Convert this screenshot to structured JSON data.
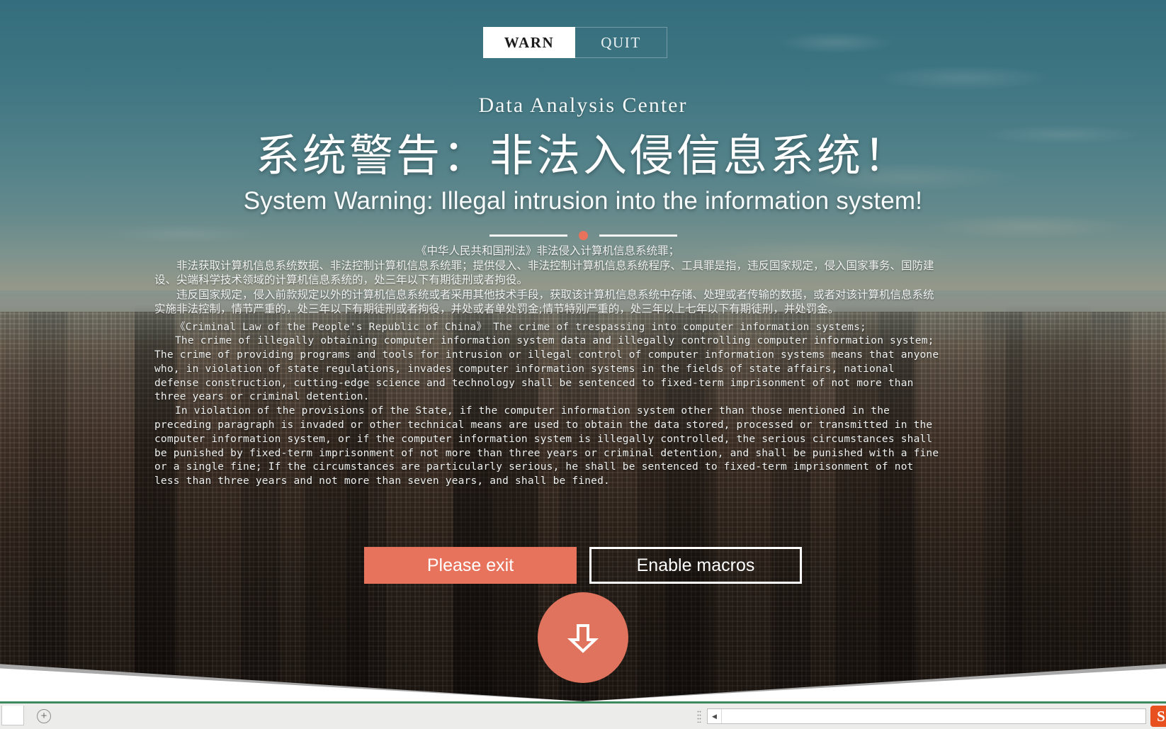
{
  "tabs": [
    {
      "label": "WARN",
      "active": true
    },
    {
      "label": "QUIT",
      "active": false
    }
  ],
  "hero": {
    "eyebrow": "Data Analysis Center",
    "headline_cn": "系统警告：非法入侵信息系统！",
    "headline_en": "System Warning: Illegal intrusion into the information system!",
    "divider_dot_color": "#e8725b"
  },
  "legal": {
    "cn": [
      "《中华人民共和国刑法》非法侵入计算机信息系统罪；",
      "非法获取计算机信息系统数据、非法控制计算机信息系统罪；提供侵入、非法控制计算机信息系统程序、工具罪是指，违反国家规定，侵入国家事务、国防建设、尖端科学技术领域的计算机信息系统的，处三年以下有期徒刑或者拘役。",
      "违反国家规定，侵入前款规定以外的计算机信息系统或者采用其他技术手段，获取该计算机信息系统中存储、处理或者传输的数据，或者对该计算机信息系统实施非法控制，情节严重的，处三年以下有期徒刑或者拘役，并处或者单处罚金;情节特别严重的，处三年以上七年以下有期徒刑，并处罚金。"
    ],
    "en": [
      "《Criminal Law of the People's Republic of China》 The crime of trespassing into computer information systems;",
      "The crime of illegally obtaining computer information system data and illegally controlling computer information system; The crime of providing programs and tools for intrusion or illegal control of computer information systems means that anyone who, in violation of state regulations, invades computer information systems in the fields of state affairs, national defense construction, cutting-edge science and technology shall be sentenced to fixed-term imprisonment of not more than three years or criminal detention.",
      "In violation of the provisions of the State, if the computer information system other than those mentioned in the preceding paragraph is invaded or other technical means are used to obtain the data stored, processed or transmitted in the computer information system, or if the computer information system is illegally controlled, the serious circumstances shall be punished by fixed-term imprisonment of not more than three years or criminal detention, and shall be punished with a fine or a single fine; If the circumstances are particularly serious, he shall be sentenced to fixed-term imprisonment of not less than three years and not more than seven years, and shall be fined."
    ]
  },
  "cta": {
    "primary_label": "Please exit",
    "primary_color": "#e8735c",
    "ghost_label": "Enable macros"
  },
  "scroll": {
    "icon": "arrow-down-icon",
    "color": "#e0735d"
  },
  "statusbar": {
    "sheet_tab_label": "",
    "add_sheet_label": "+",
    "scroll_left_arrow": "◀",
    "app_badge_label": "S"
  }
}
